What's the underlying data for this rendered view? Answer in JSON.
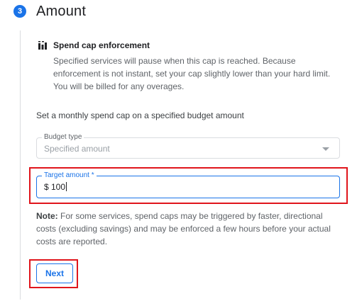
{
  "step": {
    "number": "3",
    "title": "Amount"
  },
  "callout": {
    "icon": "bar-chart-icon",
    "title": "Spend cap enforcement",
    "body": "Specified services will pause when this cap is reached. Because enforcement is not instant, set your cap slightly lower than your hard limit. You will be billed for any overages."
  },
  "description": "Set a monthly spend cap on a specified budget amount",
  "budget_type": {
    "label": "Budget type",
    "value": "Specified amount",
    "icon": "chevron-down-icon"
  },
  "target_amount": {
    "label": "Target amount *",
    "value": "$ 100"
  },
  "note": {
    "label": "Note:",
    "text": " For some services, spend caps may be triggered by faster, directional costs (excluding savings) and may be enforced a few hours before your actual costs are reported."
  },
  "next_button": {
    "label": "Next"
  },
  "colors": {
    "accent": "#1a73e8",
    "highlight": "#e0151c"
  }
}
